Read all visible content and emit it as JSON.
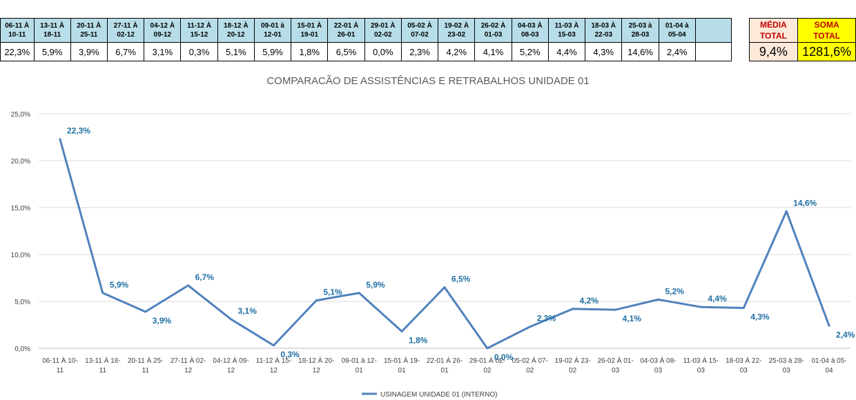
{
  "table": {
    "headers": [
      [
        "06-11 À",
        "10-11"
      ],
      [
        "13-11 À",
        "18-11"
      ],
      [
        "20-11 À",
        "25-11"
      ],
      [
        "27-11 À",
        "02-12"
      ],
      [
        "04-12 À",
        "09-12"
      ],
      [
        "11-12 À",
        "15-12"
      ],
      [
        "18-12 À",
        "20-12"
      ],
      [
        "09-01 à",
        "12-01"
      ],
      [
        "15-01 À",
        "19-01"
      ],
      [
        "22-01 À",
        "26-01"
      ],
      [
        "29-01 À",
        "02-02"
      ],
      [
        "05-02 À",
        "07-02"
      ],
      [
        "19-02 À",
        "23-02"
      ],
      [
        "26-02 À",
        "01-03"
      ],
      [
        "04-03 À",
        "08-03"
      ],
      [
        "11-03 À",
        "15-03"
      ],
      [
        "18-03 À",
        "22-03"
      ],
      [
        "25-03 à",
        "28-03"
      ],
      [
        "01-04 à",
        "05-04"
      ]
    ],
    "values": [
      "22,3%",
      "5,9%",
      "3,9%",
      "6,7%",
      "3,1%",
      "0,3%",
      "5,1%",
      "5,9%",
      "1,8%",
      "6,5%",
      "0,0%",
      "2,3%",
      "4,2%",
      "4,1%",
      "5,2%",
      "4,4%",
      "4,3%",
      "14,6%",
      "2,4%"
    ],
    "media_label": [
      "MÉDIA",
      "TOTAL"
    ],
    "media_value": "9,4%",
    "soma_label": [
      "SOMA",
      "TOTAL"
    ],
    "soma_value": "1281,6%"
  },
  "chart_data": {
    "type": "line",
    "title": "COMPARACÃO DE ASSISTÊNCIAS E RETRABALHOS UNIDADE 01",
    "categories": [
      [
        "06-11 À 10-",
        "11"
      ],
      [
        "13-11 À 18-",
        "11"
      ],
      [
        "20-11 À 25-",
        "11"
      ],
      [
        "27-11 À 02-",
        "12"
      ],
      [
        "04-12 À 09-",
        "12"
      ],
      [
        "11-12 À 15-",
        "12"
      ],
      [
        "18-12 À 20-",
        "12"
      ],
      [
        "09-01 à 12-",
        "01"
      ],
      [
        "15-01 À 19-",
        "01"
      ],
      [
        "22-01 À 26-",
        "01"
      ],
      [
        "29-01 À 02-",
        "02"
      ],
      [
        "05-02 À 07-",
        "02"
      ],
      [
        "19-02 À 23-",
        "02"
      ],
      [
        "26-02 À 01-",
        "03"
      ],
      [
        "04-03 À 08-",
        "03"
      ],
      [
        "11-03 À 15-",
        "03"
      ],
      [
        "18-03 À 22-",
        "03"
      ],
      [
        "25-03 à 28-",
        "03"
      ],
      [
        "01-04 à 05-",
        "04"
      ]
    ],
    "series": [
      {
        "name": "USINAGEM UNIDADE 01 (INTERNO)",
        "values": [
          22.3,
          5.9,
          3.9,
          6.7,
          3.1,
          0.3,
          5.1,
          5.9,
          1.8,
          6.5,
          0.0,
          2.3,
          4.2,
          4.1,
          5.2,
          4.4,
          4.3,
          14.6,
          2.4
        ],
        "labels": [
          "22,3%",
          "5,9%",
          "3,9%",
          "6,7%",
          "3,1%",
          "0,3%",
          "5,1%",
          "5,9%",
          "1,8%",
          "6,5%",
          "0,0%",
          "2,3%",
          "4,2%",
          "4,1%",
          "5,2%",
          "4,4%",
          "4,3%",
          "14,6%",
          "2,4%"
        ],
        "color": "#4f81bd"
      }
    ],
    "ylim": [
      0,
      25
    ],
    "yticks": [
      "0,0%",
      "5,0%",
      "10,0%",
      "15,0%",
      "20,0%",
      "25,0%"
    ],
    "grid": true,
    "legend_position": "bottom",
    "label_color": "#1f6fa3"
  }
}
